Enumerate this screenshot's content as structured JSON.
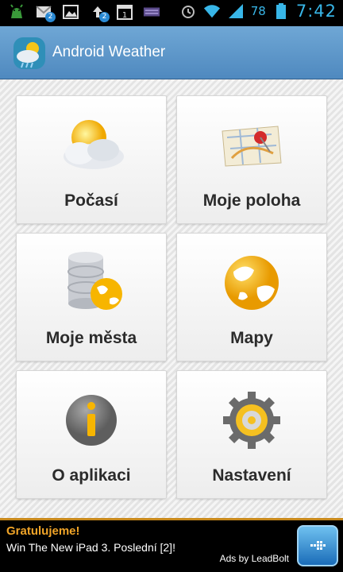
{
  "status_bar": {
    "battery": "78",
    "time": "7:42",
    "notification_badges": [
      "2",
      "2"
    ],
    "calendar_day": "1"
  },
  "action_bar": {
    "title": "Android Weather"
  },
  "tiles": [
    {
      "label": "Počasí",
      "icon": "weather-cloud-sun-icon"
    },
    {
      "label": "Moje poloha",
      "icon": "map-pin-icon"
    },
    {
      "label": "Moje města",
      "icon": "database-globe-icon"
    },
    {
      "label": "Mapy",
      "icon": "globe-icon"
    },
    {
      "label": "O aplikaci",
      "icon": "info-icon"
    },
    {
      "label": "Nastavení",
      "icon": "gear-icon"
    }
  ],
  "ad": {
    "title": "Gratulujeme!",
    "text": "Win The New iPad 3. Poslední [2]!",
    "by": "Ads by LeadBolt"
  },
  "colors": {
    "accent_blue": "#38b6e8",
    "action_bar": "#5f98c9",
    "ad_title": "#f0a428"
  }
}
